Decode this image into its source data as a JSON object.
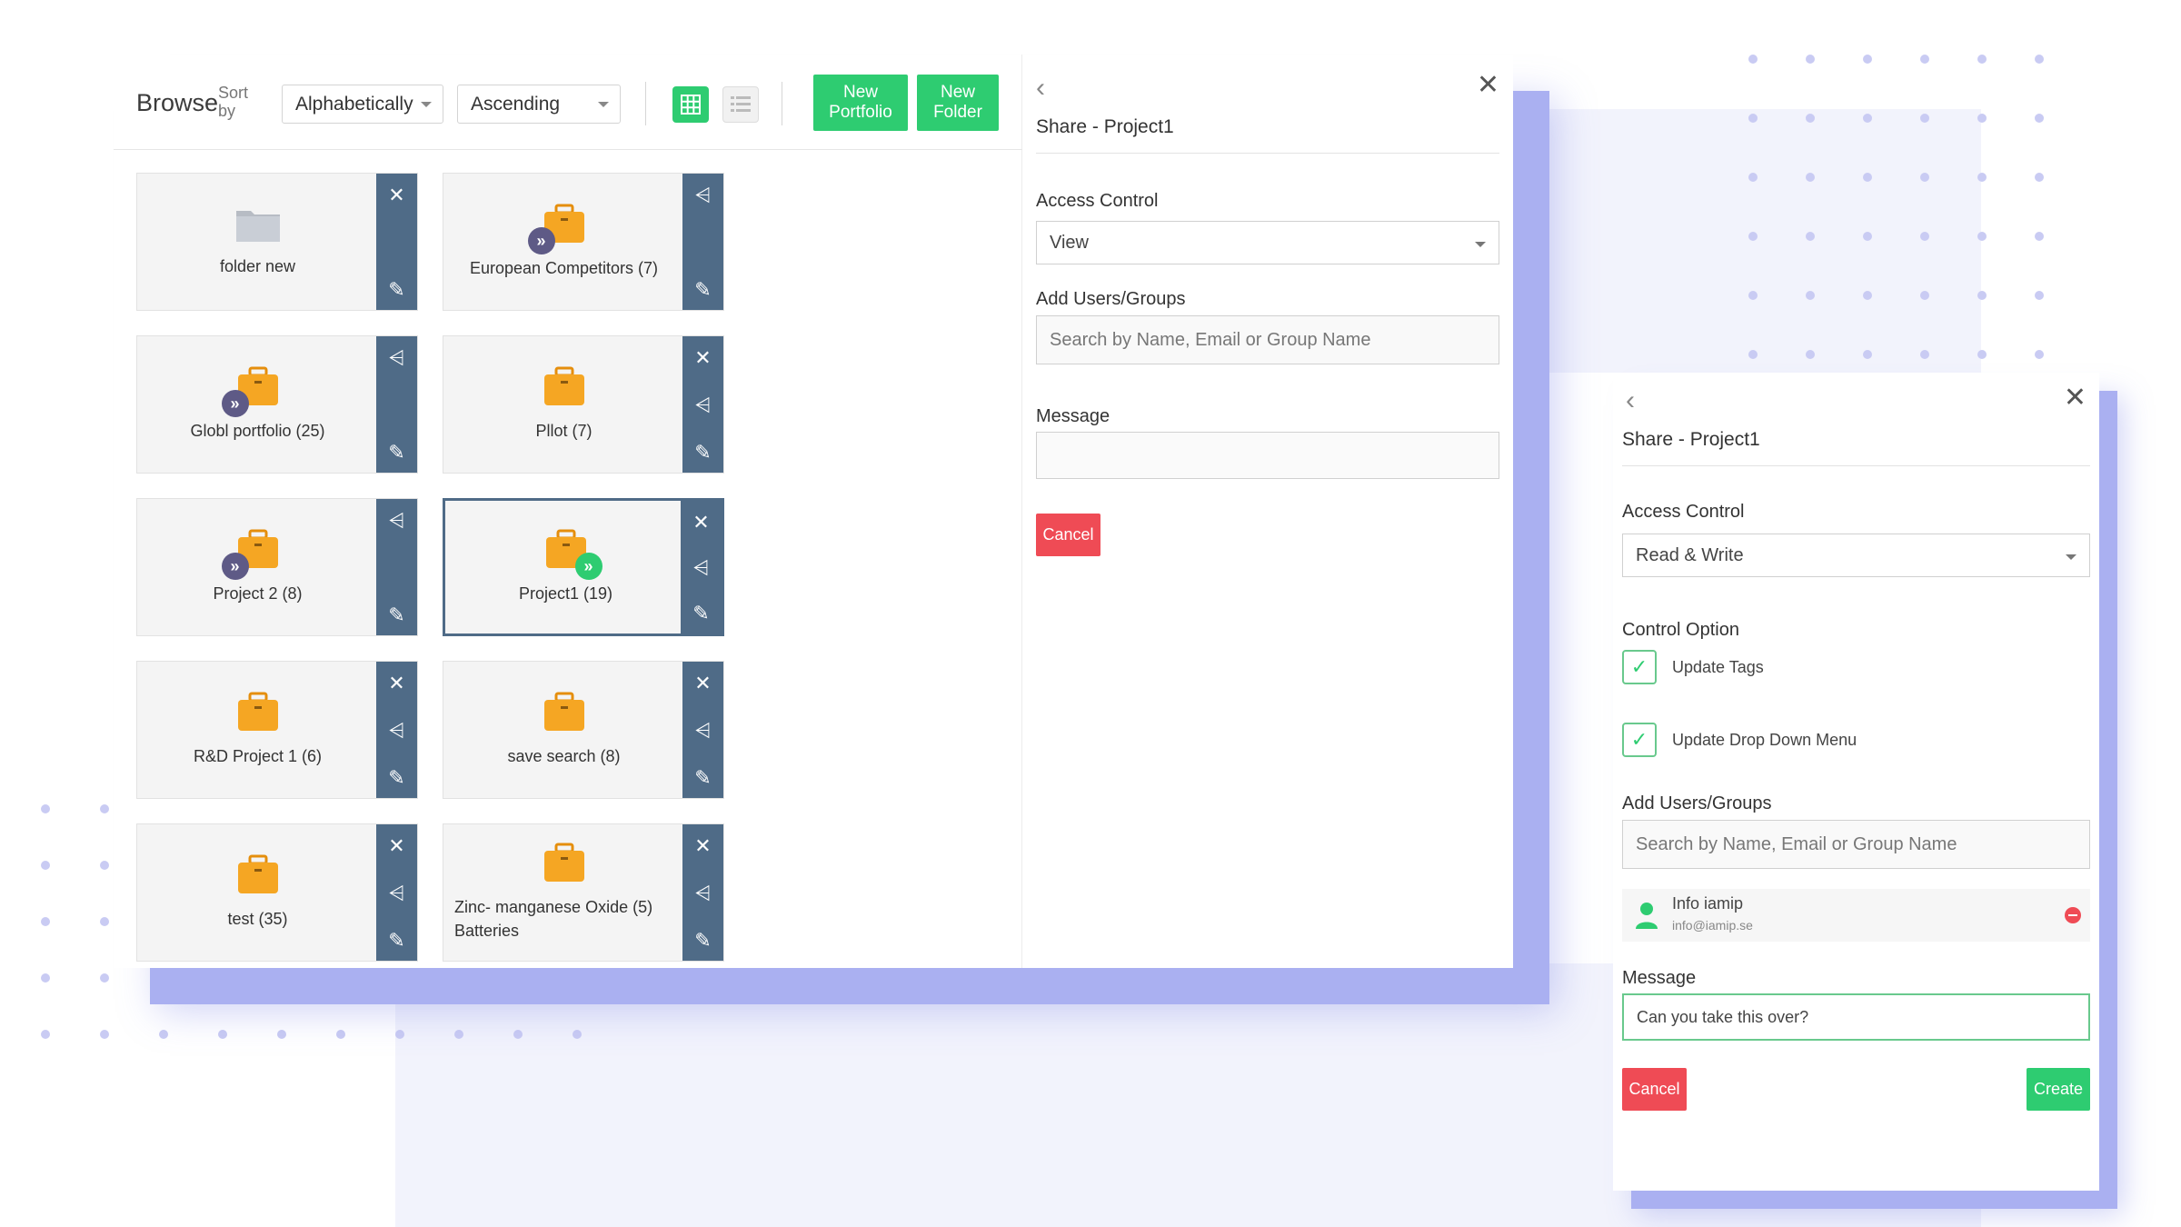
{
  "browse": {
    "title": "Browse",
    "sort_by_label": "Sort\nby",
    "sort_select": "Alphabetically",
    "order_select": "Ascending",
    "new_portfolio": "New\nPortfolio",
    "new_folder": "New\nFolder",
    "items": [
      {
        "label": "folder new",
        "kind": "folder"
      },
      {
        "label": "European Competitors (7)",
        "kind": "portfolio-shared-in"
      },
      {
        "label": "Globl portfolio (25)",
        "kind": "portfolio-shared-in"
      },
      {
        "label": "Pllot (7)",
        "kind": "portfolio"
      },
      {
        "label": "Project 2 (8)",
        "kind": "portfolio-shared-in"
      },
      {
        "label": "Project1 (19)",
        "kind": "portfolio-shared-out"
      },
      {
        "label": "R&D Project 1 (6)",
        "kind": "portfolio"
      },
      {
        "label": "save search (8)",
        "kind": "portfolio"
      },
      {
        "label": "test (35)",
        "kind": "portfolio"
      },
      {
        "label": "Zinc- manganese Oxide (5) Batteries",
        "kind": "portfolio"
      }
    ]
  },
  "share_panel": {
    "title": "Share - Project1",
    "access_control_label": "Access Control",
    "access_control_value": "View",
    "add_users_label": "Add Users/Groups",
    "search_placeholder": "Search by Name, Email or Group Name",
    "message_label": "Message",
    "cancel_label": "Cancel"
  },
  "share_panel_rw": {
    "title": "Share - Project1",
    "access_control_label": "Access Control",
    "access_control_value": "Read & Write",
    "control_option_label": "Control Option",
    "option_update_tags": "Update Tags",
    "option_update_dropdown": "Update Drop Down Menu",
    "add_users_label": "Add Users/Groups",
    "search_placeholder": "Search by Name, Email or Group Name",
    "user_name": "Info iamip",
    "user_email": "info@iamip.se",
    "message_label": "Message",
    "message_value": "Can you take this over?",
    "cancel_label": "Cancel",
    "create_label": "Create"
  },
  "colors": {
    "accent_green": "#2ecc71",
    "tile_sidebar": "#4f6b87",
    "cancel_red": "#ef4b55",
    "portfolio_orange": "#f5a623",
    "shadow_blue": "#aab0f1"
  }
}
